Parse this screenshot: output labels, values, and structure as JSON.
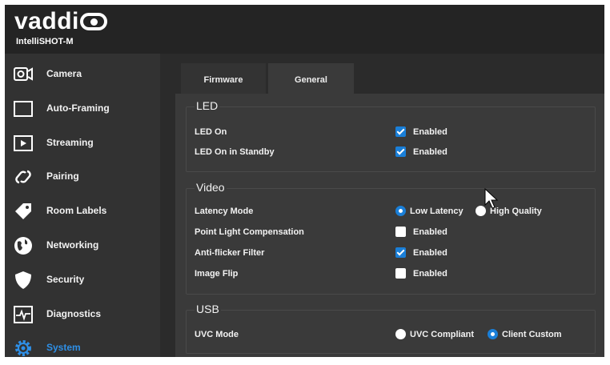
{
  "header": {
    "brand": "vaddi",
    "model": "IntelliSHOT-M"
  },
  "sidebar": {
    "items": [
      {
        "label": "Camera",
        "icon": "camera-icon"
      },
      {
        "label": "Auto-Framing",
        "icon": "frame-icon"
      },
      {
        "label": "Streaming",
        "icon": "play-icon"
      },
      {
        "label": "Pairing",
        "icon": "link-icon"
      },
      {
        "label": "Room Labels",
        "icon": "tag-icon"
      },
      {
        "label": "Networking",
        "icon": "globe-icon"
      },
      {
        "label": "Security",
        "icon": "shield-icon"
      },
      {
        "label": "Diagnostics",
        "icon": "pulse-icon"
      },
      {
        "label": "System",
        "icon": "gear-icon",
        "active": true
      }
    ]
  },
  "tabs": [
    {
      "label": "Firmware"
    },
    {
      "label": "General",
      "active": true
    }
  ],
  "led": {
    "title": "LED",
    "rows": [
      {
        "label": "LED On",
        "option": "Enabled",
        "checked": true
      },
      {
        "label": "LED On in Standby",
        "option": "Enabled",
        "checked": true
      }
    ]
  },
  "video": {
    "title": "Video",
    "latency": {
      "label": "Latency Mode",
      "options": [
        "Low Latency",
        "High Quality"
      ],
      "selected": "Low Latency"
    },
    "rows": [
      {
        "label": "Point Light Compensation",
        "option": "Enabled",
        "checked": false
      },
      {
        "label": "Anti-flicker Filter",
        "option": "Enabled",
        "checked": true
      },
      {
        "label": "Image Flip",
        "option": "Enabled",
        "checked": false
      }
    ]
  },
  "usb": {
    "title": "USB",
    "uvc": {
      "label": "UVC Mode",
      "options": [
        "UVC Compliant",
        "Client Custom"
      ],
      "selected": "Client Custom"
    }
  },
  "colors": {
    "accent": "#1a7fd8",
    "active_nav": "#2e8fe6",
    "background": "#2b2b2b",
    "panel": "#3a3a3a"
  }
}
